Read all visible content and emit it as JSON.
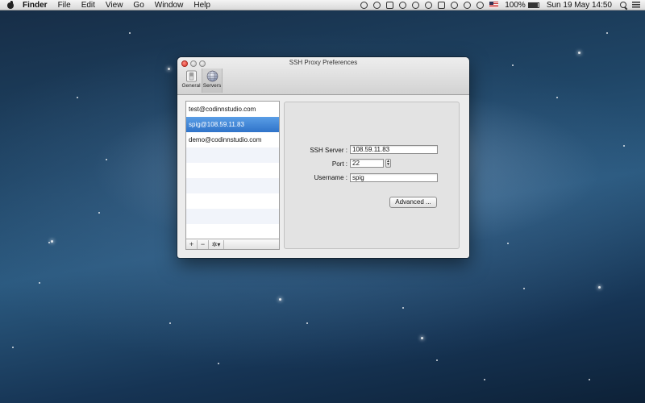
{
  "menubar": {
    "app": "Finder",
    "menus": [
      "File",
      "Edit",
      "View",
      "Go",
      "Window",
      "Help"
    ],
    "battery": "100%",
    "clock": "Sun 19 May  14:50"
  },
  "window": {
    "title": "SSH Proxy Preferences",
    "toolbar": [
      {
        "label": "General",
        "icon": "general-switch-icon"
      },
      {
        "label": "Servers",
        "icon": "servers-globe-icon",
        "selected": true
      }
    ]
  },
  "server_list": {
    "items": [
      {
        "label": "test@codinnstudio.com",
        "selected": false
      },
      {
        "label": "spig@108.59.11.83",
        "selected": true
      },
      {
        "label": "demo@codinnstudio.com",
        "selected": false
      }
    ],
    "add_label": "+",
    "remove_label": "−",
    "action_label": "✲▾"
  },
  "detail": {
    "ssh_server_label": "SSH Server :",
    "ssh_server_value": "108.59.11.83",
    "port_label": "Port :",
    "port_value": "22",
    "username_label": "Username :",
    "username_value": "spig",
    "advanced_label": "Advanced ..."
  },
  "colors": {
    "selection": "#3f86d9",
    "close_button": "#e0443a"
  }
}
